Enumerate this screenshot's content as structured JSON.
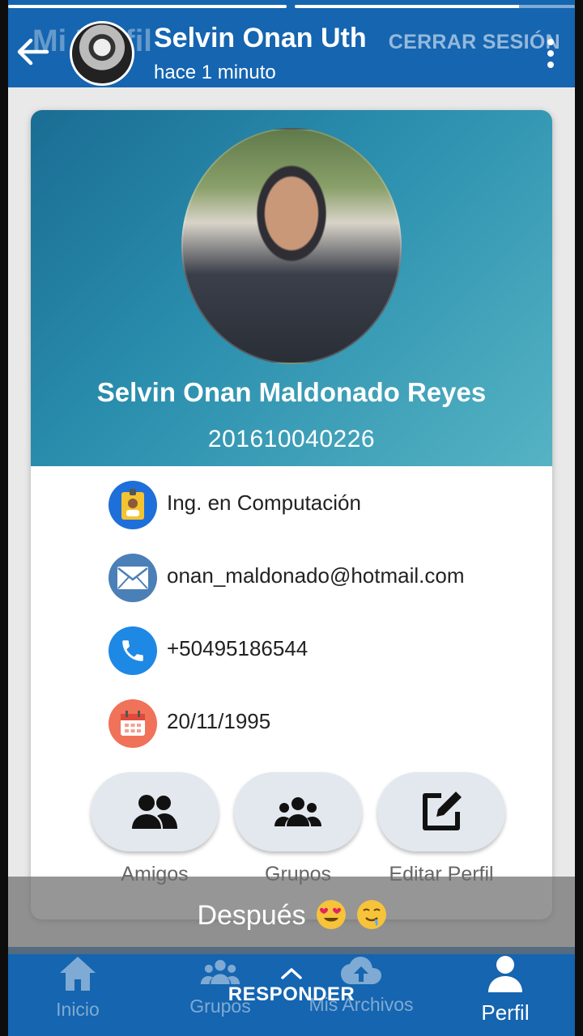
{
  "story": {
    "user_name": "Selvin Onan Uth",
    "time": "hace 1 minuto",
    "progress": [
      1.0,
      0.8
    ],
    "caption": "Después",
    "reply_label": "RESPONDER"
  },
  "app": {
    "title": "Mi Perfil",
    "logout": "CERRAR SESIÓN",
    "brand_color": "#1565b0"
  },
  "profile": {
    "name": "Selvin Onan Maldonado Reyes",
    "id": "201610040226",
    "info": [
      {
        "icon": "id-badge-icon",
        "text": "Ing. en Computación"
      },
      {
        "icon": "email-icon",
        "text": "onan_maldonado@hotmail.com"
      },
      {
        "icon": "phone-icon",
        "text": "+50495186544"
      },
      {
        "icon": "calendar-icon",
        "text": "20/11/1995"
      }
    ],
    "actions": [
      {
        "icon": "friends-icon",
        "label": "Amigos"
      },
      {
        "icon": "groups-icon",
        "label": "Grupos"
      },
      {
        "icon": "edit-icon",
        "label": "Editar Perfil"
      }
    ]
  },
  "nav": [
    {
      "icon": "home-icon",
      "label": "Inicio",
      "active": false
    },
    {
      "icon": "groups-icon",
      "label": "Grupos",
      "active": false
    },
    {
      "icon": "cloud-upload-icon",
      "label": "Mis Archivos",
      "active": false
    },
    {
      "icon": "person-icon",
      "label": "Perfil",
      "active": true
    }
  ]
}
